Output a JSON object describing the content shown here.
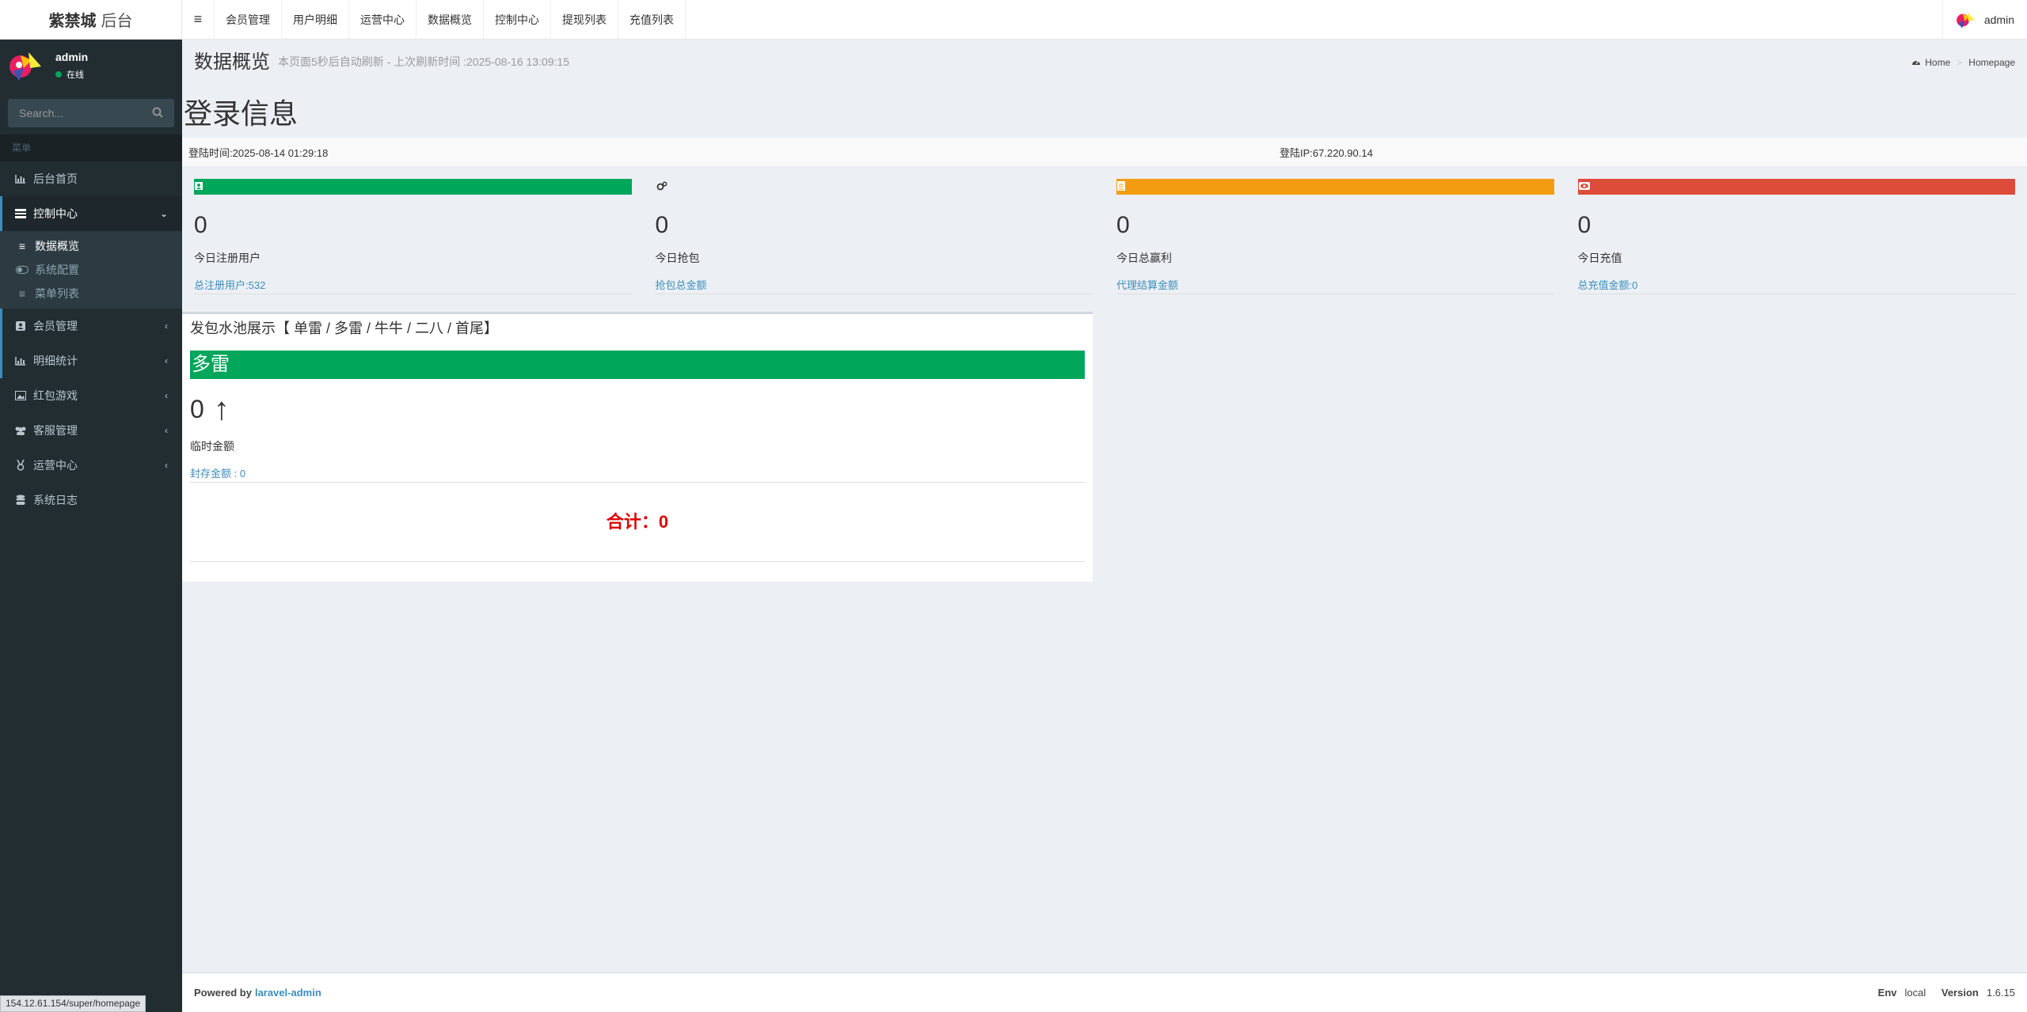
{
  "brand": {
    "name_bold": "紫禁城",
    "name_light": "后台"
  },
  "user": {
    "name": "admin",
    "status": "在线"
  },
  "sidebar": {
    "search_placeholder": "Search...",
    "menu_header": "菜单",
    "items": [
      {
        "label": "后台首页",
        "icon": "bar-chart-icon"
      },
      {
        "label": "控制中心",
        "icon": "tasks-icon",
        "expanded": true,
        "children": [
          {
            "label": "数据概览",
            "icon": "list-icon"
          },
          {
            "label": "系统配置",
            "icon": "toggle-icon"
          },
          {
            "label": "菜单列表",
            "icon": "list-icon"
          }
        ]
      },
      {
        "label": "会员管理",
        "icon": "user-square-icon"
      },
      {
        "label": "明细统计",
        "icon": "bar-chart-icon"
      },
      {
        "label": "红包游戏",
        "icon": "image-icon"
      },
      {
        "label": "客服管理",
        "icon": "users-icon"
      },
      {
        "label": "运营中心",
        "icon": "medal-icon"
      },
      {
        "label": "系统日志",
        "icon": "database-icon"
      }
    ]
  },
  "topnav": {
    "links": [
      "会员管理",
      "用户明细",
      "运营中心",
      "数据概览",
      "控制中心",
      "提现列表",
      "充值列表"
    ],
    "user": "admin"
  },
  "header": {
    "title": "数据概览",
    "subtitle": "本页面5秒后自动刷新 - 上次刷新时间 :2025-08-16 13:09:15",
    "breadcrumb_home": "Home",
    "breadcrumb_current": "Homepage"
  },
  "login": {
    "title": "登录信息",
    "time": "登陆时间:2025-08-14 01:29:18",
    "ip": "登陆IP:67.220.90.14"
  },
  "stats": [
    {
      "color": "#00a65a",
      "icon": "user-plus-icon",
      "value": "0",
      "label": "今日注册用户",
      "foot": "总注册用户:532"
    },
    {
      "color": "",
      "icon": "cogs-icon",
      "value": "0",
      "label": "今日抢包",
      "foot": "抢包总金额"
    },
    {
      "color": "#f39c12",
      "icon": "file-icon",
      "value": "0",
      "label": "今日总赢利",
      "foot": "代理结算金额"
    },
    {
      "color": "#dd4b39",
      "icon": "eye-icon",
      "value": "0",
      "label": "今日充值",
      "foot": "总充值金额:0"
    }
  ],
  "pool": {
    "title": "发包水池展示【 单雷 / 多雷 / 牛牛 / 二八 / 首尾】",
    "bar_label": "多雷",
    "value": "0",
    "arrow": "↑",
    "label": "临时金额",
    "foot": "封存金额 : 0",
    "total": "合计：0"
  },
  "footer": {
    "powered": "Powered by",
    "link": "laravel-admin",
    "env_label": "Env",
    "env_value": "local",
    "version_label": "Version",
    "version_value": "1.6.15"
  },
  "statusbar": "154.12.61.154/super/homepage"
}
